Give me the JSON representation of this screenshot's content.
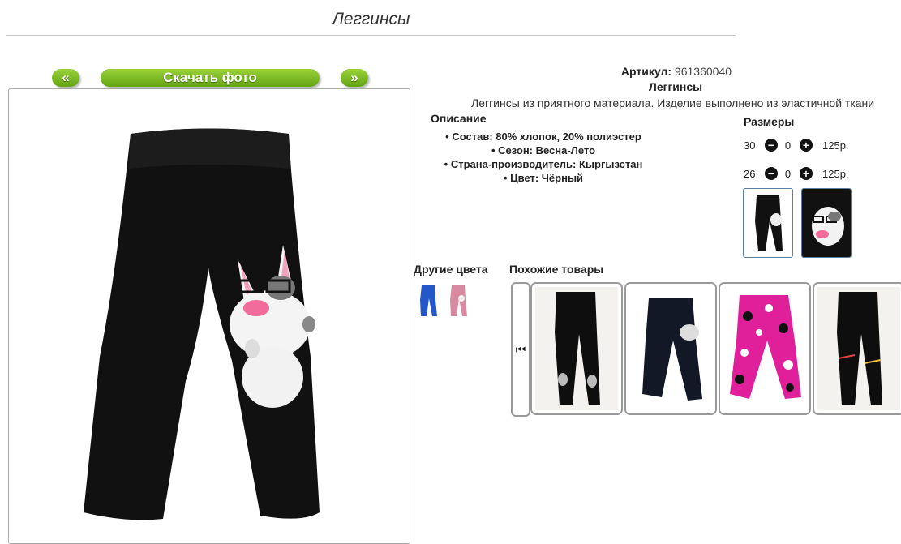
{
  "page": {
    "title": "Леггинсы"
  },
  "nav": {
    "prev": "«",
    "download": "Скачать фото",
    "next": "»"
  },
  "product": {
    "article_label": "Артикул:",
    "article_value": "961360040",
    "name": "Леггинсы",
    "summary": "Леггинсы из приятного материала. Изделие выполнено из эластичной ткани"
  },
  "description": {
    "heading": "Описание",
    "items": [
      "Состав: 80% хлопок, 20% полиэстер",
      "Сезон: Весна-Лето",
      "Страна-производитель: Кыргызстан",
      "Цвет: Чёрный"
    ]
  },
  "sizes": {
    "heading": "Размеры",
    "rows": [
      {
        "size": "30",
        "qty": "0",
        "price": "125р."
      },
      {
        "size": "26",
        "qty": "0",
        "price": "125р."
      }
    ],
    "minus_glyph": "−",
    "plus_glyph": "+"
  },
  "other_colors": {
    "heading": "Другие цвета",
    "swatches": [
      "#2458c8",
      "#d88aa0"
    ]
  },
  "similar": {
    "heading": "Похожие товары",
    "scroll_glyph": "⏮"
  },
  "colors": {
    "accent_green": "#63a413",
    "border_blue": "#5a7da0"
  }
}
